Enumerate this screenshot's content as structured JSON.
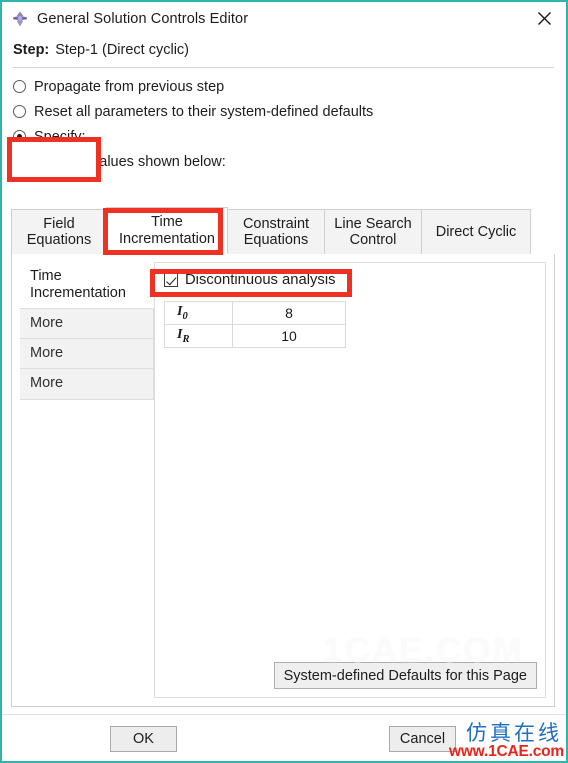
{
  "window": {
    "title": "General Solution Controls Editor",
    "icon": "abaqus-diamond-icon",
    "close_icon": "close-icon",
    "border_color": "#2fb5ad"
  },
  "step": {
    "label": "Step:",
    "value": "Step-1 (Direct cyclic)"
  },
  "radios": [
    {
      "label": "Propagate from previous step",
      "checked": false
    },
    {
      "label": "Reset all parameters to their system-defined defaults",
      "checked": false
    },
    {
      "label": "Specify:",
      "checked": true
    }
  ],
  "propagated_note": "Propagated values shown below:",
  "tabs": [
    {
      "line1": "Field",
      "line2": "Equations",
      "active": false
    },
    {
      "line1": "Time",
      "line2": "Incrementation",
      "active": true
    },
    {
      "line1": "Constraint",
      "line2": "Equations",
      "active": false
    },
    {
      "line1": "Line Search",
      "line2": "Control",
      "active": false
    },
    {
      "line1": "Direct Cyclic",
      "line2": "",
      "active": false
    }
  ],
  "subtabs": [
    {
      "line1": "Time",
      "line2": "Incrementation",
      "active": true
    },
    {
      "line1": "More",
      "line2": "",
      "active": false
    },
    {
      "line1": "More",
      "line2": "",
      "active": false
    },
    {
      "line1": "More",
      "line2": "",
      "active": false
    }
  ],
  "detail": {
    "checkbox": {
      "label": "Discontinuous analysis",
      "checked": true
    },
    "table": {
      "rows": [
        {
          "key": "I",
          "sub": "0",
          "value": "8"
        },
        {
          "key": "I",
          "sub": "R",
          "value": "10"
        }
      ]
    },
    "defaults_button": "System-defined Defaults for this Page"
  },
  "footer": {
    "ok": "OK",
    "cancel": "Cancel"
  },
  "annotations": {
    "color": "#ef3124",
    "boxes": [
      "specify-radio",
      "time-incrementation-tab",
      "discontinuous-analysis-checkbox"
    ]
  },
  "watermarks": {
    "center": "1CAE.COM",
    "corner_cn": "仿真在线",
    "corner_url": "www.1CAE.com",
    "corner_cn_color": "#1f6fc4",
    "corner_url_color": "#e8241b"
  }
}
